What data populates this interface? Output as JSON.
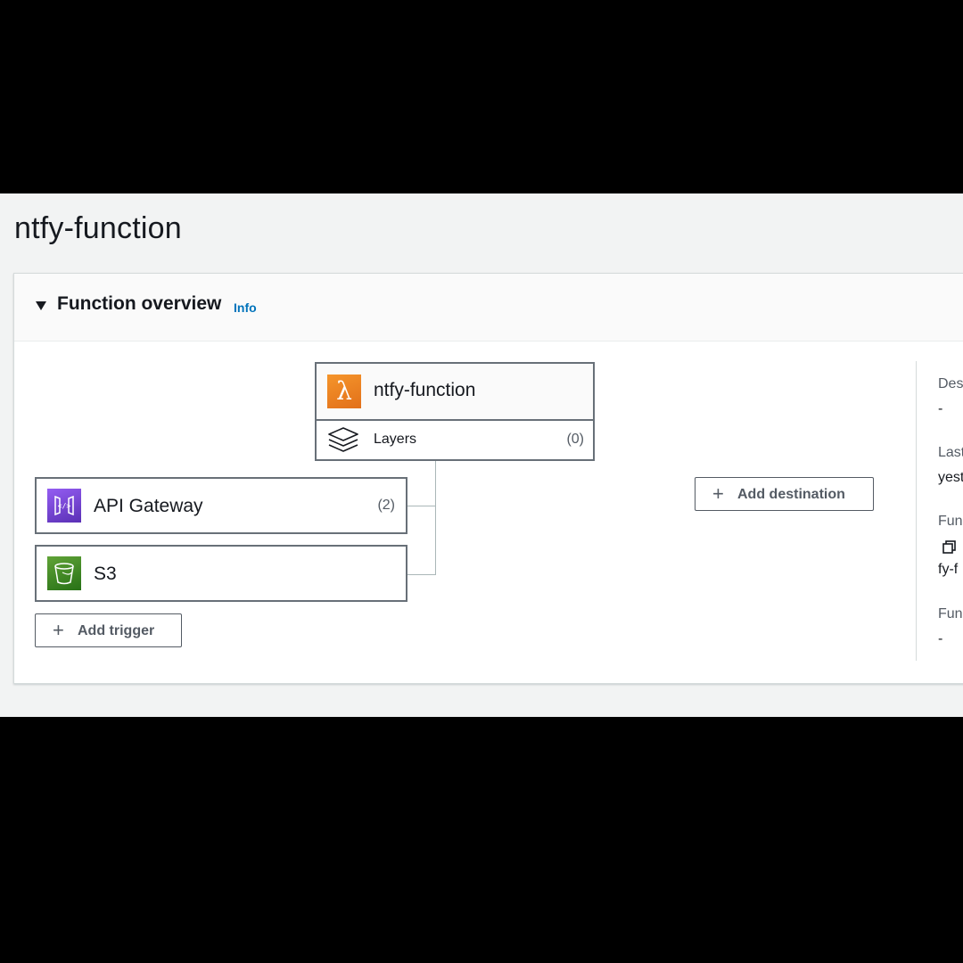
{
  "page": {
    "title": "ntfy-function"
  },
  "overview": {
    "heading": "Function overview",
    "info_link": "Info",
    "function_node": {
      "name": "ntfy-function",
      "icon": "lambda-icon",
      "layers_label": "Layers",
      "layers_count": "(0)"
    },
    "triggers": [
      {
        "name": "API Gateway",
        "count": "(2)",
        "icon": "api-gateway-icon"
      },
      {
        "name": "S3",
        "count": "",
        "icon": "s3-bucket-icon"
      }
    ],
    "add_trigger_label": "Add trigger",
    "add_destination_label": "Add destination"
  },
  "details": {
    "description_label": "Des",
    "description_value": "-",
    "last_modified_label": "Last",
    "last_modified_value": "yest",
    "function_arn_label": "Fun",
    "function_arn_value": "fy-f",
    "function_url_label": "Fun",
    "function_url_value": "-"
  },
  "colors": {
    "lambda_orange": "#e2701a",
    "api_gateway_purple": "#7b45e0",
    "s3_green": "#3f8624",
    "link_blue": "#0073bb",
    "border_gray": "#687078"
  }
}
